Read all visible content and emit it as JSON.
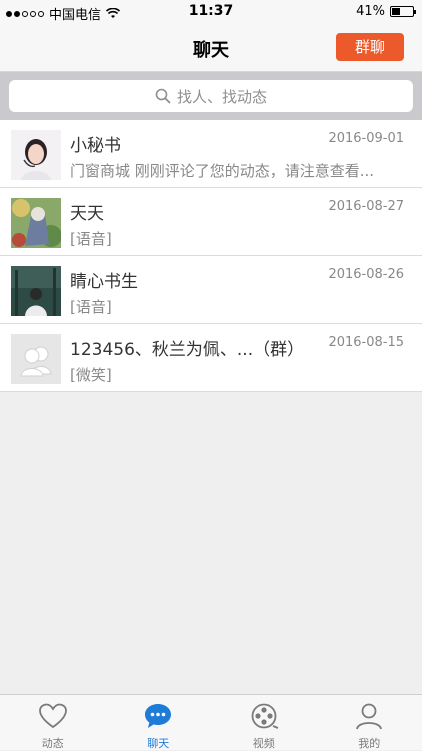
{
  "status_bar": {
    "carrier": "中国电信",
    "time": "11:37",
    "battery": "41%",
    "battery_level": 0.41,
    "signal_bars_filled": 2,
    "signal_bars_total": 5
  },
  "nav": {
    "title": "聊天",
    "group_button": "群聊"
  },
  "search": {
    "placeholder": "找人、找动态"
  },
  "chats": [
    {
      "name": "小秘书",
      "date": "2016-09-01",
      "preview": "门窗商城 刚刚评论了您的动态，请注意查看..."
    },
    {
      "name": "天天",
      "date": "2016-08-27",
      "preview": "[语音]"
    },
    {
      "name": "睛心书生",
      "date": "2016-08-26",
      "preview": "[语音]"
    },
    {
      "name": "123456、秋兰为佩、...（群）",
      "date": "2016-08-15",
      "preview": "[微笑]"
    }
  ],
  "tabs": [
    {
      "label": "动态",
      "icon": "heart-icon",
      "active": false
    },
    {
      "label": "聊天",
      "icon": "chat-bubble-icon",
      "active": true
    },
    {
      "label": "视频",
      "icon": "film-reel-icon",
      "active": false
    },
    {
      "label": "我的",
      "icon": "person-icon",
      "active": false
    }
  ],
  "colors": {
    "accent": "#ec5a2b",
    "tab_active": "#1e7cd8",
    "background": "#efefef"
  }
}
